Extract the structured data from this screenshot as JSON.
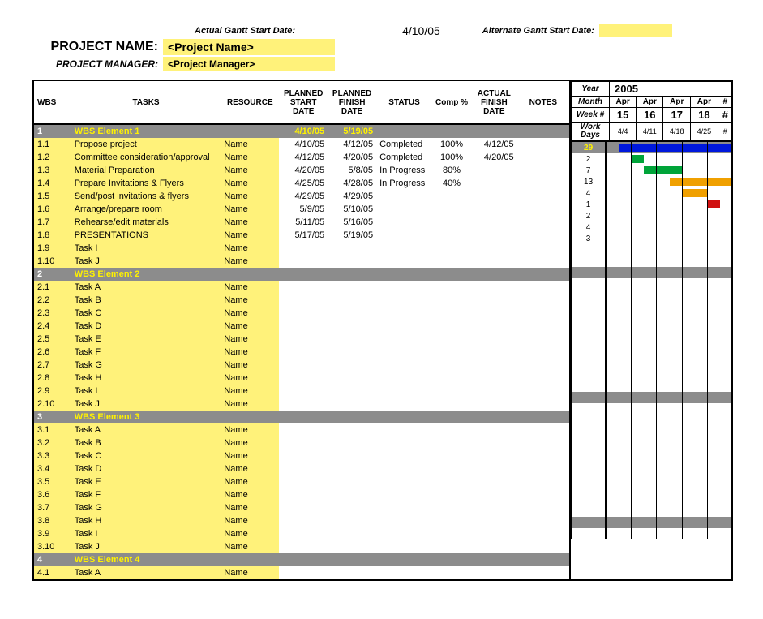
{
  "header": {
    "actual_gantt_label": "Actual Gantt Start Date:",
    "actual_gantt_value": "4/10/05",
    "alt_gantt_label": "Alternate Gantt Start Date:",
    "project_name_label": "PROJECT NAME:",
    "project_name_value": "<Project Name>",
    "project_manager_label": "PROJECT MANAGER:",
    "project_manager_value": "<Project Manager>"
  },
  "columns": {
    "wbs": "WBS",
    "tasks": "TASKS",
    "resource": "RESOURCE",
    "planned_start_1": "PLANNED",
    "planned_start_2": "START",
    "planned_start_3": "DATE",
    "planned_finish_1": "PLANNED",
    "planned_finish_2": "FINISH",
    "planned_finish_3": "DATE",
    "status": "STATUS",
    "comp": "Comp %",
    "actual_1": "ACTUAL",
    "actual_2": "FINISH",
    "actual_3": "DATE",
    "notes": "NOTES"
  },
  "timeline": {
    "year_label": "Year",
    "year_value": "2005",
    "month_label": "Month",
    "months": [
      "Apr",
      "Apr",
      "Apr",
      "Apr",
      "#"
    ],
    "week_label": "Week #",
    "weeks": [
      "15",
      "16",
      "17",
      "18",
      "#"
    ],
    "workdays_label": "Work Days",
    "week_dates": [
      "4/4",
      "4/11",
      "4/18",
      "4/25",
      "#"
    ]
  },
  "rows": [
    {
      "type": "group",
      "wbs": "1",
      "task": "WBS Element 1",
      "start": "4/10/05",
      "finish": "5/19/05",
      "wd": "29",
      "gantt": [
        [
          "blue",
          "half-r"
        ],
        [
          "blue",
          ""
        ],
        [
          "blue",
          ""
        ],
        [
          "blue",
          ""
        ],
        [
          "blue",
          ""
        ]
      ]
    },
    {
      "type": "data",
      "hl": true,
      "wbs": "1.1",
      "task": "Propose project",
      "resource": "Name",
      "start": "4/10/05",
      "finish": "4/12/05",
      "status": "Completed",
      "comp": "100%",
      "actual": "4/12/05",
      "wd": "2",
      "gantt": [
        null,
        [
          "green",
          "half-l"
        ],
        null,
        null,
        null
      ]
    },
    {
      "type": "data",
      "hl": true,
      "wbs": "1.2",
      "task": "Committee consideration/approval",
      "resource": "Name",
      "start": "4/12/05",
      "finish": "4/20/05",
      "status": "Completed",
      "comp": "100%",
      "actual": "4/20/05",
      "wd": "7",
      "gantt": [
        null,
        [
          "green",
          "half-r"
        ],
        [
          "green",
          ""
        ],
        null,
        null
      ]
    },
    {
      "type": "data",
      "hl": true,
      "wbs": "1.3",
      "task": "Material Preparation",
      "resource": "Name",
      "start": "4/20/05",
      "finish": "5/8/05",
      "status": "In Progress",
      "comp": "80%",
      "wd": "13",
      "gantt": [
        null,
        null,
        [
          "orange",
          "half-r"
        ],
        [
          "orange",
          ""
        ],
        [
          "orange",
          ""
        ]
      ]
    },
    {
      "type": "data",
      "hl": true,
      "wbs": "1.4",
      "task": "Prepare Invitations & Flyers",
      "resource": "Name",
      "start": "4/25/05",
      "finish": "4/28/05",
      "status": "In Progress",
      "comp": "40%",
      "wd": "4",
      "gantt": [
        null,
        null,
        null,
        [
          "orange",
          ""
        ],
        null
      ]
    },
    {
      "type": "data",
      "hl": true,
      "wbs": "1.5",
      "task": "Send/post invitations & flyers",
      "resource": "Name",
      "start": "4/29/05",
      "finish": "4/29/05",
      "wd": "1",
      "gantt": [
        null,
        null,
        null,
        null,
        [
          "red",
          "half-l"
        ]
      ]
    },
    {
      "type": "data",
      "hl": true,
      "wbs": "1.6",
      "task": "Arrange/prepare room",
      "resource": "Name",
      "start": "5/9/05",
      "finish": "5/10/05",
      "wd": "2",
      "gantt": [
        null,
        null,
        null,
        null,
        null
      ]
    },
    {
      "type": "data",
      "hl": true,
      "wbs": "1.7",
      "task": "Rehearse/edit materials",
      "resource": "Name",
      "start": "5/11/05",
      "finish": "5/16/05",
      "wd": "4",
      "gantt": [
        null,
        null,
        null,
        null,
        null
      ]
    },
    {
      "type": "data",
      "hl": true,
      "wbs": "1.8",
      "task": "PRESENTATIONS",
      "resource": "Name",
      "start": "5/17/05",
      "finish": "5/19/05",
      "wd": "3",
      "gantt": [
        null,
        null,
        null,
        null,
        null
      ]
    },
    {
      "type": "data",
      "hl": true,
      "wbs": "1.9",
      "task": "Task I",
      "resource": "Name",
      "wd": "",
      "gantt": [
        null,
        null,
        null,
        null,
        null
      ]
    },
    {
      "type": "data",
      "hl": true,
      "wbs": "1.10",
      "task": "Task J",
      "resource": "Name",
      "wd": "",
      "gantt": [
        null,
        null,
        null,
        null,
        null
      ]
    },
    {
      "type": "group",
      "wbs": "2",
      "task": "WBS Element 2",
      "wd": "",
      "gantt": [
        null,
        null,
        null,
        null,
        null
      ]
    },
    {
      "type": "data",
      "hl": true,
      "wbs": "2.1",
      "task": "Task A",
      "resource": "Name",
      "wd": "",
      "gantt": [
        null,
        null,
        null,
        null,
        null
      ]
    },
    {
      "type": "data",
      "hl": true,
      "wbs": "2.2",
      "task": "Task B",
      "resource": "Name",
      "wd": "",
      "gantt": [
        null,
        null,
        null,
        null,
        null
      ]
    },
    {
      "type": "data",
      "hl": true,
      "wbs": "2.3",
      "task": "Task C",
      "resource": "Name",
      "wd": "",
      "gantt": [
        null,
        null,
        null,
        null,
        null
      ]
    },
    {
      "type": "data",
      "hl": true,
      "wbs": "2.4",
      "task": "Task D",
      "resource": "Name",
      "wd": "",
      "gantt": [
        null,
        null,
        null,
        null,
        null
      ]
    },
    {
      "type": "data",
      "hl": true,
      "wbs": "2.5",
      "task": "Task E",
      "resource": "Name",
      "wd": "",
      "gantt": [
        null,
        null,
        null,
        null,
        null
      ]
    },
    {
      "type": "data",
      "hl": true,
      "wbs": "2.6",
      "task": "Task F",
      "resource": "Name",
      "wd": "",
      "gantt": [
        null,
        null,
        null,
        null,
        null
      ]
    },
    {
      "type": "data",
      "hl": true,
      "wbs": "2.7",
      "task": "Task G",
      "resource": "Name",
      "wd": "",
      "gantt": [
        null,
        null,
        null,
        null,
        null
      ]
    },
    {
      "type": "data",
      "hl": true,
      "wbs": "2.8",
      "task": "Task H",
      "resource": "Name",
      "wd": "",
      "gantt": [
        null,
        null,
        null,
        null,
        null
      ]
    },
    {
      "type": "data",
      "hl": true,
      "wbs": "2.9",
      "task": "Task I",
      "resource": "Name",
      "wd": "",
      "gantt": [
        null,
        null,
        null,
        null,
        null
      ]
    },
    {
      "type": "data",
      "hl": true,
      "wbs": "2.10",
      "task": "Task J",
      "resource": "Name",
      "wd": "",
      "gantt": [
        null,
        null,
        null,
        null,
        null
      ]
    },
    {
      "type": "group",
      "wbs": "3",
      "task": "WBS Element 3",
      "wd": "",
      "gantt": [
        null,
        null,
        null,
        null,
        null
      ]
    },
    {
      "type": "data",
      "hl": true,
      "wbs": "3.1",
      "task": "Task A",
      "resource": "Name",
      "wd": "",
      "gantt": [
        null,
        null,
        null,
        null,
        null
      ]
    },
    {
      "type": "data",
      "hl": true,
      "wbs": "3.2",
      "task": "Task B",
      "resource": "Name",
      "wd": "",
      "gantt": [
        null,
        null,
        null,
        null,
        null
      ]
    },
    {
      "type": "data",
      "hl": true,
      "wbs": "3.3",
      "task": "Task C",
      "resource": "Name",
      "wd": "",
      "gantt": [
        null,
        null,
        null,
        null,
        null
      ]
    },
    {
      "type": "data",
      "hl": true,
      "wbs": "3.4",
      "task": "Task D",
      "resource": "Name",
      "wd": "",
      "gantt": [
        null,
        null,
        null,
        null,
        null
      ]
    },
    {
      "type": "data",
      "hl": true,
      "wbs": "3.5",
      "task": "Task E",
      "resource": "Name",
      "wd": "",
      "gantt": [
        null,
        null,
        null,
        null,
        null
      ]
    },
    {
      "type": "data",
      "hl": true,
      "wbs": "3.6",
      "task": "Task F",
      "resource": "Name",
      "wd": "",
      "gantt": [
        null,
        null,
        null,
        null,
        null
      ]
    },
    {
      "type": "data",
      "hl": true,
      "wbs": "3.7",
      "task": "Task G",
      "resource": "Name",
      "wd": "",
      "gantt": [
        null,
        null,
        null,
        null,
        null
      ]
    },
    {
      "type": "data",
      "hl": true,
      "wbs": "3.8",
      "task": "Task H",
      "resource": "Name",
      "wd": "",
      "gantt": [
        null,
        null,
        null,
        null,
        null
      ]
    },
    {
      "type": "data",
      "hl": true,
      "wbs": "3.9",
      "task": "Task I",
      "resource": "Name",
      "wd": "",
      "gantt": [
        null,
        null,
        null,
        null,
        null
      ]
    },
    {
      "type": "data",
      "hl": true,
      "wbs": "3.10",
      "task": "Task J",
      "resource": "Name",
      "wd": "",
      "gantt": [
        null,
        null,
        null,
        null,
        null
      ]
    },
    {
      "type": "group",
      "wbs": "4",
      "task": "WBS Element 4",
      "wd": "",
      "gantt": [
        null,
        null,
        null,
        null,
        null
      ]
    },
    {
      "type": "data",
      "hl": true,
      "wbs": "4.1",
      "task": "Task A",
      "resource": "Name",
      "wd": "",
      "gantt": [
        null,
        null,
        null,
        null,
        null
      ]
    }
  ],
  "chart_data": {
    "type": "bar",
    "title": "Gantt Chart – 2005",
    "xlabel": "Week #",
    "categories": [
      "15",
      "16",
      "17",
      "18"
    ],
    "x_dates": [
      "4/4",
      "4/11",
      "4/18",
      "4/25"
    ],
    "series": [
      {
        "name": "WBS Element 1",
        "start": "4/10/05",
        "finish": "5/19/05",
        "work_days": 29,
        "color": "blue"
      },
      {
        "name": "Propose project",
        "start": "4/10/05",
        "finish": "4/12/05",
        "work_days": 2,
        "color": "green"
      },
      {
        "name": "Committee consideration/approval",
        "start": "4/12/05",
        "finish": "4/20/05",
        "work_days": 7,
        "color": "green"
      },
      {
        "name": "Material Preparation",
        "start": "4/20/05",
        "finish": "5/8/05",
        "work_days": 13,
        "color": "orange"
      },
      {
        "name": "Prepare Invitations & Flyers",
        "start": "4/25/05",
        "finish": "4/28/05",
        "work_days": 4,
        "color": "orange"
      },
      {
        "name": "Send/post invitations & flyers",
        "start": "4/29/05",
        "finish": "4/29/05",
        "work_days": 1,
        "color": "red"
      },
      {
        "name": "Arrange/prepare room",
        "start": "5/9/05",
        "finish": "5/10/05",
        "work_days": 2
      },
      {
        "name": "Rehearse/edit materials",
        "start": "5/11/05",
        "finish": "5/16/05",
        "work_days": 4
      },
      {
        "name": "PRESENTATIONS",
        "start": "5/17/05",
        "finish": "5/19/05",
        "work_days": 3
      }
    ]
  }
}
